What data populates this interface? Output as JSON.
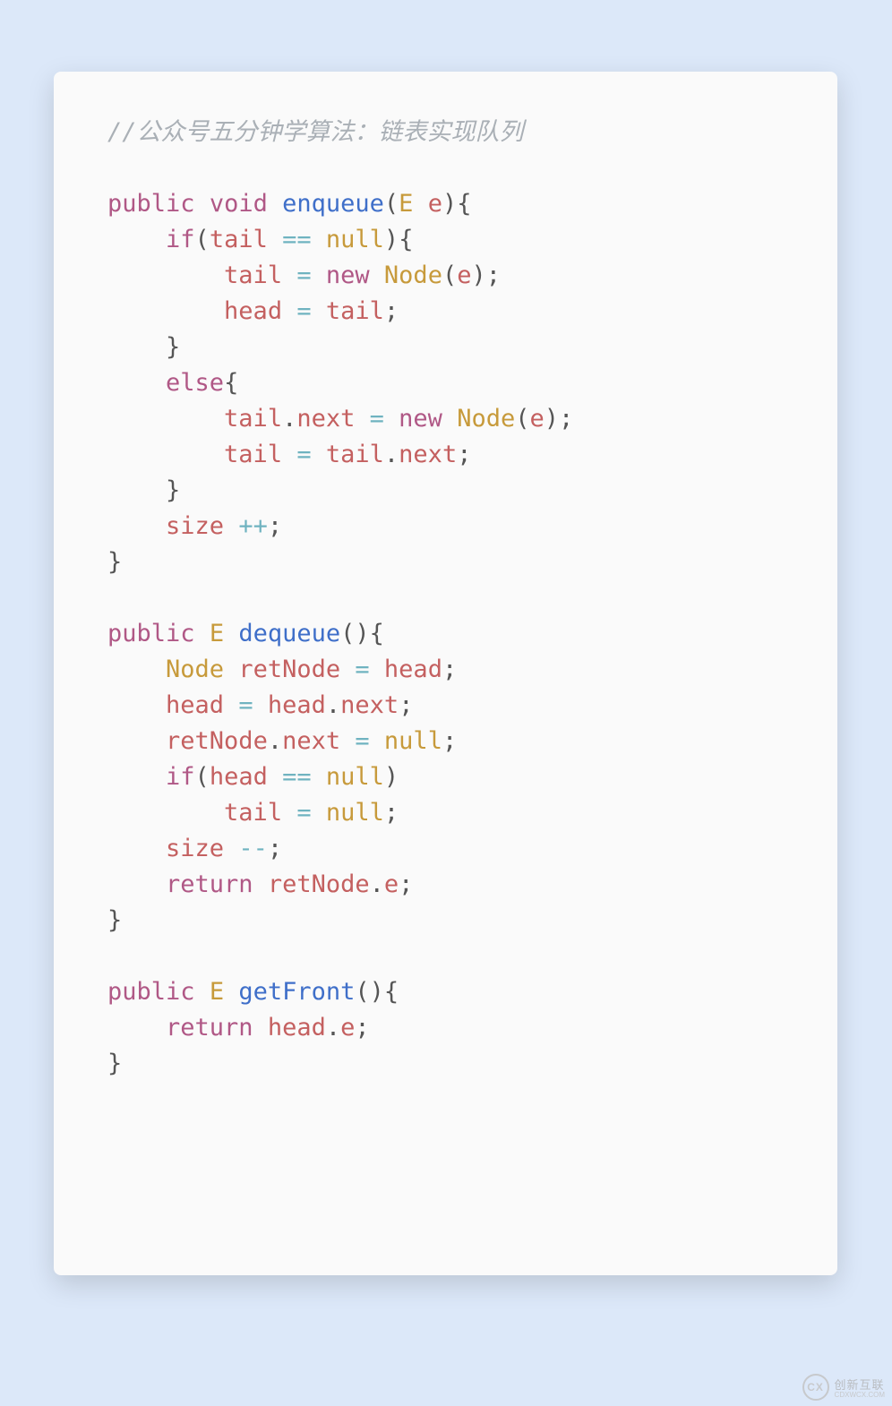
{
  "code": {
    "comment": "//公众号五分钟学算法：链表实现队列",
    "tokens": {
      "public": "public",
      "void": "void",
      "if": "if",
      "else": "else",
      "new": "new",
      "return": "return",
      "null": "null",
      "E": "E",
      "Node": "Node",
      "enqueue": "enqueue",
      "dequeue": "dequeue",
      "getFront": "getFront",
      "tail": "tail",
      "head": "head",
      "size": "size",
      "next": "next",
      "e": "e",
      "retNode": "retNode",
      "eq_eq": "==",
      "assign": "=",
      "plusplus": "++",
      "minusminus": "--",
      "lparen": "(",
      "rparen": ")",
      "lbrace": "{",
      "rbrace": "}",
      "semi": ";",
      "dot": ".",
      "space": " "
    }
  },
  "raw_code": "//公众号五分钟学算法：链表实现队列\n\npublic void enqueue(E e){\n    if(tail == null){\n        tail = new Node(e);\n        head = tail;\n    }\n    else{\n        tail.next = new Node(e);\n        tail = tail.next;\n    }\n    size ++;\n}\n\npublic E dequeue(){\n    Node retNode = head;\n    head = head.next;\n    retNode.next = null;\n    if(head == null)\n        tail = null;\n    size --;\n    return retNode.e;\n}\n\npublic E getFront(){\n    return head.e;\n}",
  "watermark": {
    "brand": "创新互联",
    "sub": "CDXWCX.COM"
  }
}
